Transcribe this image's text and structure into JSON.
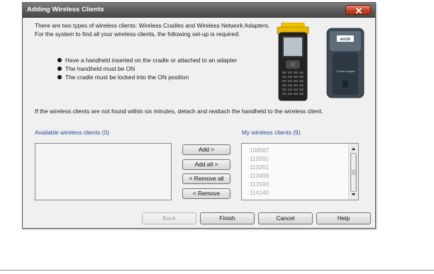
{
  "dialog": {
    "title": "Adding Wireless Clients",
    "intro_text": "There are two types of wireless clients: Wireless Cradles and Wireless Network Adapters. For the system to find all your wireless clients, the following set-up is required:",
    "requirements": [
      "Have a handheld inserted on the cradle or attached to an adapter",
      "The handheld must be ON",
      "The cradle must be locked into the ON position"
    ],
    "note_text": "If the wireless clients are not found within six minutes, detach and reattach the handheld to the wireless client.",
    "available_label": "Available wireless clients (0)",
    "my_label": "My wireless clients (9)",
    "available_clients": [],
    "my_clients": [
      "108587",
      "112001",
      "113261",
      "113409",
      "113593",
      "114140"
    ],
    "adapter_label": "TI-Nspire Navigator"
  },
  "buttons": {
    "add": "Add >",
    "add_all": "Add all >",
    "remove_all": "< Remove all",
    "remove": "< Remove",
    "back": "Back",
    "finish": "Finish",
    "cancel": "Cancel",
    "help": "Help"
  },
  "colors": {
    "title_bar": "#5b5b5b",
    "close_button": "#c8432a",
    "label_blue": "#2c4a9a",
    "cradle_yellow": "#f2c400"
  },
  "icons": {
    "close": "close-icon",
    "scroll_up": "scroll-up-arrow-icon",
    "scroll_down": "scroll-down-arrow-icon"
  }
}
